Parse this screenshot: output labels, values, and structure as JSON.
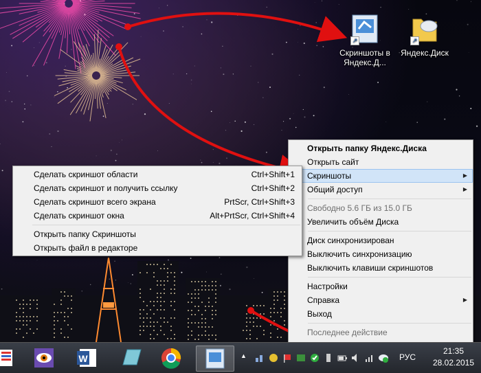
{
  "desktop": {
    "icons": [
      {
        "label": "Скриншоты в Яндекс.Д..."
      },
      {
        "label": "Яндекс.Диск"
      }
    ]
  },
  "tray_menu": {
    "items": [
      {
        "label": "Открыть папку Яндекс.Диска",
        "bold": true
      },
      {
        "label": "Открыть сайт"
      },
      {
        "label": "Скриншоты",
        "submenu": true,
        "highlighted": true
      },
      {
        "label": "Общий доступ",
        "submenu": true
      },
      {
        "label": "Свободно 5.6 ГБ из 15.0 ГБ",
        "disabled": true
      },
      {
        "label": "Увеличить объём Диска"
      },
      {
        "label": "Диск синхронизирован"
      },
      {
        "label": "Выключить синхронизацию"
      },
      {
        "label": "Выключить клавиши скриншотов"
      },
      {
        "label": "Настройки"
      },
      {
        "label": "Справка",
        "submenu": true
      },
      {
        "label": "Выход"
      },
      {
        "label": "Последнее действие",
        "disabled": true
      }
    ]
  },
  "screenshot_menu": {
    "items": [
      {
        "label": "Сделать скриншот области",
        "shortcut": "Ctrl+Shift+1"
      },
      {
        "label": "Сделать скриншот и получить ссылку",
        "shortcut": "Ctrl+Shift+2"
      },
      {
        "label": "Сделать скриншот всего экрана",
        "shortcut": "PrtScr, Ctrl+Shift+3"
      },
      {
        "label": "Сделать скриншот окна",
        "shortcut": "Alt+PrtScr, Ctrl+Shift+4"
      },
      {
        "label": "Открыть папку Скриншоты"
      },
      {
        "label": "Открыть файл в редакторе"
      }
    ]
  },
  "taskbar": {
    "apps": [
      {
        "icon": "start-icon"
      },
      {
        "icon": "faststone-viewer-icon"
      },
      {
        "icon": "word-icon",
        "label": "W"
      },
      {
        "icon": "notepad-icon"
      },
      {
        "icon": "chrome-icon"
      },
      {
        "icon": "yandex-screenshots-icon",
        "active": true
      }
    ],
    "language": "РУС",
    "time": "21:35",
    "date": "28.02.2015"
  },
  "colors": {
    "arrow": "#e01010",
    "highlight": "#d1e4f8",
    "menu_bg": "#f0f0f0"
  }
}
